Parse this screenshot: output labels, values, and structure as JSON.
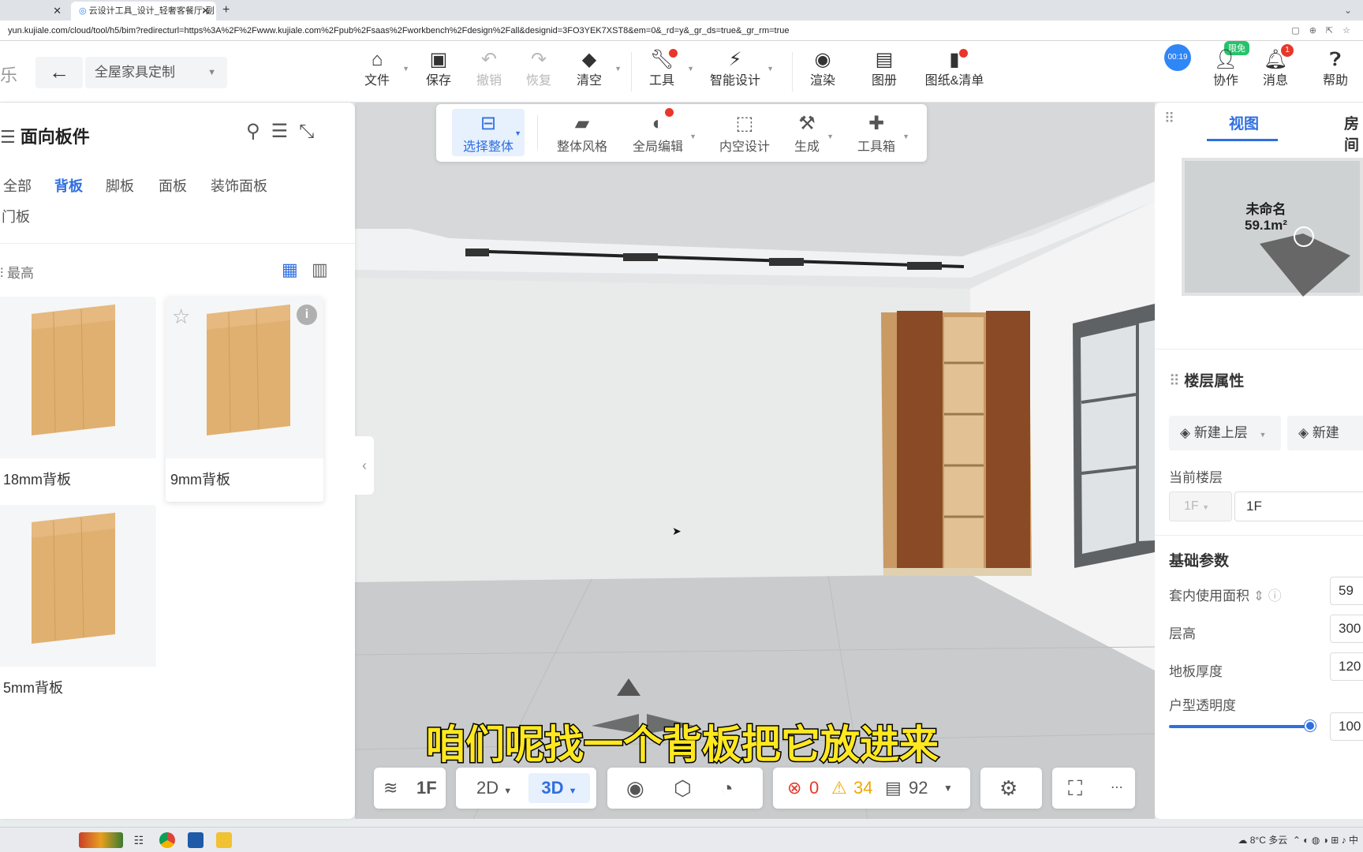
{
  "browser": {
    "tabs": [
      {
        "title": ""
      },
      {
        "title": "云设计工具_设计_轻奢客餐厅-副"
      }
    ],
    "url": "yun.kujiale.com/cloud/tool/h5/bim?redirecturl=https%3A%2F%2Fwww.kujiale.com%2Fpub%2Fsaas%2Fworkbench%2Fdesign%2Fall&designid=3FO3YEK7XST8&em=0&_rd=y&_gr_ds=true&_gr_rm=true"
  },
  "header": {
    "brand": "乐",
    "project_selector": "全屋家具定制",
    "tools": [
      {
        "label": "文件",
        "icon": "file-icon"
      },
      {
        "label": "保存",
        "icon": "save-icon"
      },
      {
        "label": "撤销",
        "icon": "undo-icon",
        "disabled": true
      },
      {
        "label": "恢复",
        "icon": "redo-icon",
        "disabled": true
      },
      {
        "label": "清空",
        "icon": "eraser-icon"
      },
      {
        "label": "工具",
        "icon": "wrench-icon"
      },
      {
        "label": "智能设计",
        "icon": "lightning-icon"
      },
      {
        "label": "渲染",
        "icon": "camera-icon"
      },
      {
        "label": "图册",
        "icon": "album-icon"
      },
      {
        "label": "图纸&清单",
        "icon": "document-icon"
      }
    ],
    "timer": "00:19",
    "vip_badge": "限免",
    "right_tools": [
      {
        "label": "协作",
        "icon": "collaborate-icon"
      },
      {
        "label": "消息",
        "icon": "bell-icon"
      },
      {
        "label": "帮助",
        "icon": "help-icon"
      }
    ],
    "message_count": "1"
  },
  "left_panel": {
    "title": "面向板件",
    "categories": [
      "全部",
      "背板",
      "脚板",
      "面板",
      "装饰面板",
      "门板"
    ],
    "active_category": "背板",
    "sort_label": "最高",
    "products": [
      {
        "name": "18mm背板"
      },
      {
        "name": "9mm背板"
      },
      {
        "name": "5mm背板"
      }
    ]
  },
  "float_toolbar": {
    "items": [
      {
        "label": "选择整体",
        "icon": "select-icon"
      },
      {
        "label": "整体风格",
        "icon": "paint-roller-icon"
      },
      {
        "label": "全局编辑",
        "icon": "palette-icon"
      },
      {
        "label": "内空设计",
        "icon": "frame-icon"
      },
      {
        "label": "生成",
        "icon": "hammer-icon"
      },
      {
        "label": "工具箱",
        "icon": "puzzle-icon"
      }
    ]
  },
  "bottom_bar": {
    "floor": "1F",
    "mode_2d": "2D",
    "mode_3d": "3D",
    "errors": "0",
    "warnings": "34",
    "items_count": "92"
  },
  "subtitle": "咱们呢找一个背板把它放进来",
  "right_panel": {
    "tabs": [
      "视图",
      "房间"
    ],
    "room_name": "未命名",
    "room_area": "59.1m²",
    "floor_props_title": "楼层属性",
    "btn_new_upper": "新建上层",
    "btn_new_lower": "新建",
    "current_floor_label": "当前楼层",
    "current_floor_select": "1F",
    "current_floor_value": "1F",
    "basic_params_title": "基础参数",
    "params": [
      {
        "label": "套内使用面积",
        "value": "59"
      },
      {
        "label": "层高",
        "value": "300"
      },
      {
        "label": "地板厚度",
        "value": "120"
      }
    ],
    "transparency_label": "户型透明度",
    "transparency_value": "100"
  },
  "taskbar": {
    "tray_text": "8°C 多云",
    "ime": "中"
  }
}
